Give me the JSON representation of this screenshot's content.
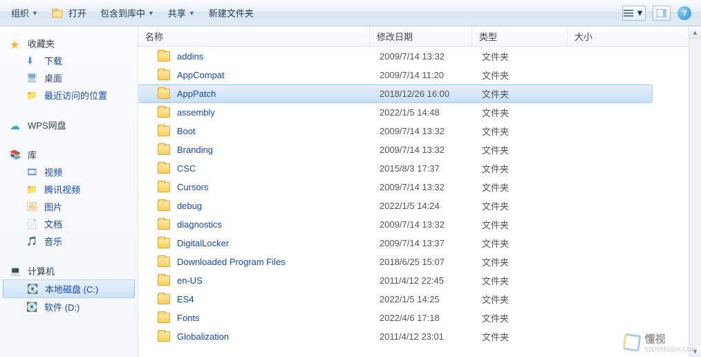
{
  "toolbar": {
    "organize": "组织",
    "open": "打开",
    "include_lib": "包含到库中",
    "share": "共享",
    "new_folder": "新建文件夹"
  },
  "sidebar": {
    "favorites": {
      "label": "收藏夹",
      "items": [
        {
          "label": "下载"
        },
        {
          "label": "桌面"
        },
        {
          "label": "最近访问的位置"
        }
      ]
    },
    "wps": {
      "label": "WPS网盘"
    },
    "libraries": {
      "label": "库",
      "items": [
        {
          "label": "视频"
        },
        {
          "label": "腾讯视频"
        },
        {
          "label": "图片"
        },
        {
          "label": "文档"
        },
        {
          "label": "音乐"
        }
      ]
    },
    "computer": {
      "label": "计算机",
      "items": [
        {
          "label": "本地磁盘 (C:)",
          "selected": true
        },
        {
          "label": "软件 (D:)"
        }
      ]
    }
  },
  "columns": {
    "name": "名称",
    "date": "修改日期",
    "type": "类型",
    "size": "大小"
  },
  "rows": [
    {
      "name": "addins",
      "date": "2009/7/14 13:32",
      "type": "文件夹"
    },
    {
      "name": "AppCompat",
      "date": "2009/7/14 11:20",
      "type": "文件夹"
    },
    {
      "name": "AppPatch",
      "date": "2018/12/26 16:00",
      "type": "文件夹",
      "selected": true
    },
    {
      "name": "assembly",
      "date": "2022/1/5 14:48",
      "type": "文件夹"
    },
    {
      "name": "Boot",
      "date": "2009/7/14 13:32",
      "type": "文件夹"
    },
    {
      "name": "Branding",
      "date": "2009/7/14 13:32",
      "type": "文件夹"
    },
    {
      "name": "CSC",
      "date": "2015/8/3 17:37",
      "type": "文件夹"
    },
    {
      "name": "Cursors",
      "date": "2009/7/14 13:32",
      "type": "文件夹"
    },
    {
      "name": "debug",
      "date": "2022/1/5 14:24",
      "type": "文件夹"
    },
    {
      "name": "diagnostics",
      "date": "2009/7/14 13:32",
      "type": "文件夹"
    },
    {
      "name": "DigitalLocker",
      "date": "2009/7/14 13:37",
      "type": "文件夹"
    },
    {
      "name": "Downloaded Program Files",
      "date": "2018/6/25 15:07",
      "type": "文件夹"
    },
    {
      "name": "en-US",
      "date": "2011/4/12 22:45",
      "type": "文件夹"
    },
    {
      "name": "ES4",
      "date": "2022/1/5 14:25",
      "type": "文件夹"
    },
    {
      "name": "Fonts",
      "date": "2022/4/6 17:18",
      "type": "文件夹"
    },
    {
      "name": "Globalization",
      "date": "2011/4/12 23:01",
      "type": "文件夹"
    }
  ],
  "watermark": {
    "text": "懂视",
    "sub": "51DONGSHI.COM"
  }
}
